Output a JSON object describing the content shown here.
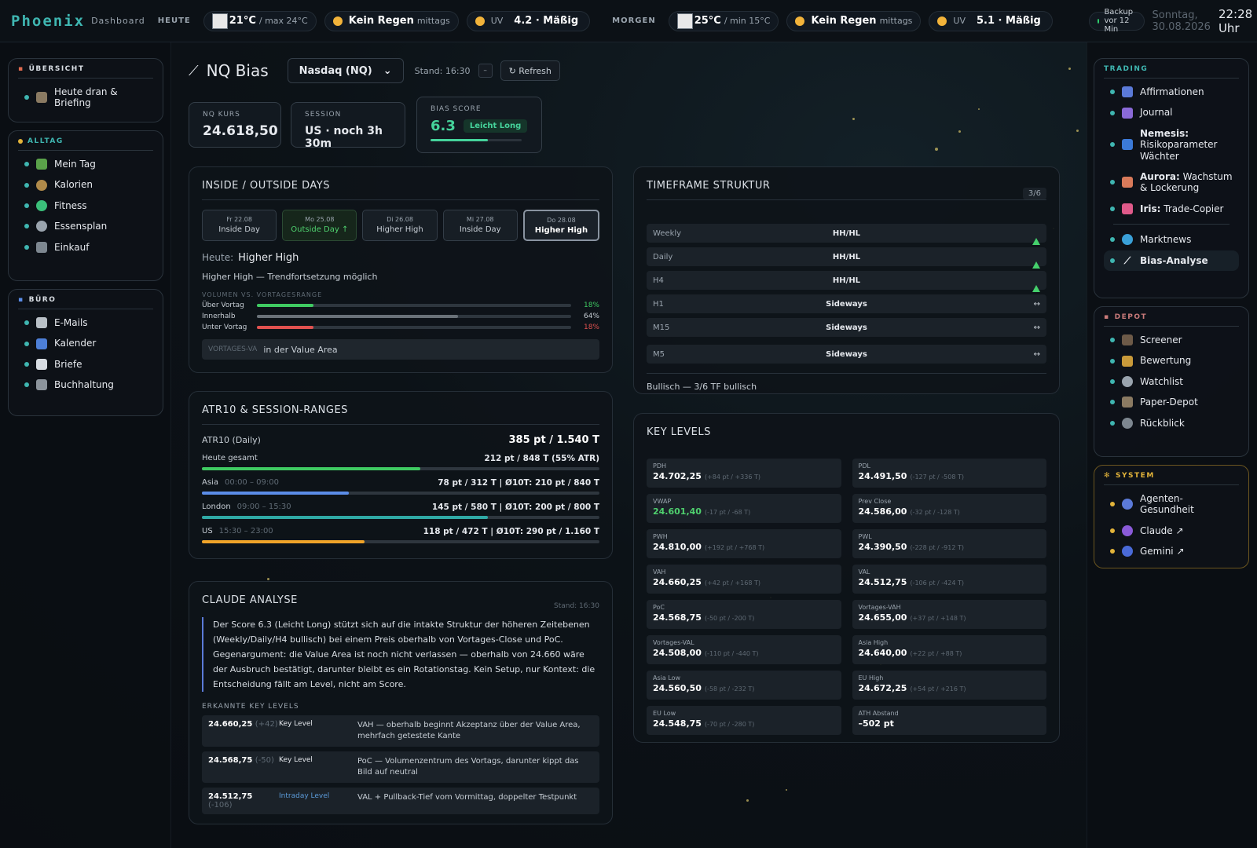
{
  "topbar": {
    "logo": "Phoenix",
    "logo_sub": "Dashboard",
    "heute_label": "HEUTE",
    "morgen_label": "MORGEN",
    "today": {
      "temp": "21°C",
      "max": "/ max 24°C",
      "rain": "Kein Regen",
      "rain_when": "mittags",
      "uv_label": "UV",
      "uv": "4.2 · Mäßig"
    },
    "tomorrow": {
      "temp": "25°C",
      "min": "/ min 15°C",
      "rain": "Kein Regen",
      "rain_when": "mittags",
      "uv_label": "UV",
      "uv": "5.1 · Mäßig"
    },
    "backup": "Backup vor 12 Min",
    "date": "Sonntag, 30.08.2026",
    "time": "22:28 Uhr"
  },
  "left": {
    "uebersicht": {
      "title": "ÜBERSICHT",
      "items": [
        "Heute dran & Briefing"
      ]
    },
    "alltag": {
      "title": "ALLTAG",
      "items": [
        "Mein Tag",
        "Kalorien",
        "Fitness",
        "Essensplan",
        "Einkauf"
      ]
    },
    "buero": {
      "title": "BÜRO",
      "items": [
        "E-Mails",
        "Kalender",
        "Briefe",
        "Buchhaltung"
      ]
    }
  },
  "right": {
    "trading": {
      "title": "TRADING",
      "items": [
        {
          "b": "",
          "t": "Affirmationen"
        },
        {
          "b": "",
          "t": "Journal"
        },
        {
          "b": "Nemesis:",
          "t": " Risikoparameter Wächter"
        },
        {
          "b": "Aurora:",
          "t": " Wachstum & Lockerung"
        },
        {
          "b": "Iris:",
          "t": " Trade-Copier"
        }
      ],
      "items2": [
        "Marktnews",
        "Bias-Analyse"
      ]
    },
    "depot": {
      "title": "DEPOT",
      "items": [
        "Screener",
        "Bewertung",
        "Watchlist",
        "Paper-Depot",
        "Rückblick"
      ]
    },
    "system": {
      "title": "SYSTEM",
      "items": [
        "Agenten-Gesundheit",
        "Claude ↗",
        "Gemini ↗"
      ]
    }
  },
  "header": {
    "title": "NQ Bias",
    "select": "Nasdaq (NQ)",
    "stand": "Stand: 16:30",
    "minus": "–",
    "refresh": "↻ Refresh"
  },
  "stats": {
    "kurs_label": "NQ KURS",
    "kurs": "24.618,50",
    "session_label": "SESSION",
    "session": "US · noch 3h 30m",
    "bias_label": "BIAS SCORE",
    "bias": "6.3",
    "bias_tag": "Leicht Long",
    "bias_fraction": 0.63
  },
  "inside": {
    "title": "INSIDE / OUTSIDE DAYS",
    "days": [
      {
        "d": "Fr 22.08",
        "t": "Inside Day"
      },
      {
        "d": "Mo 25.08",
        "t": "Outside Day ↑"
      },
      {
        "d": "Di 26.08",
        "t": "Higher High"
      },
      {
        "d": "Mi 27.08",
        "t": "Inside Day"
      },
      {
        "d": "Do 28.08",
        "t": "Higher High"
      }
    ],
    "heute_label": "Heute:",
    "heute": "Higher High",
    "desc": "Higher High — Trendfortsetzung möglich",
    "vol_title": "VOLUMEN VS. VORTAGESRANGE",
    "vol": [
      {
        "l": "Über Vortag",
        "p": "18%",
        "v": 18,
        "c": "#3fcb62"
      },
      {
        "l": "Innerhalb",
        "p": "64%",
        "v": 64,
        "c": "#6a7279"
      },
      {
        "l": "Unter Vortag",
        "p": "18%",
        "v": 18,
        "c": "#e0514f"
      }
    ],
    "va_label": "VORTAGES-VA",
    "va": "in der Value Area"
  },
  "timeframe": {
    "title": "TIMEFRAME STRUKTUR",
    "count": "3/6",
    "rows": [
      {
        "k": "Weekly",
        "v": "HH/HL",
        "up": true
      },
      {
        "k": "Daily",
        "v": "HH/HL",
        "up": true
      },
      {
        "k": "H4",
        "v": "HH/HL",
        "up": true
      },
      {
        "k": "H1",
        "v": "Sideways",
        "up": false
      },
      {
        "k": "M15",
        "v": "Sideways",
        "up": false
      },
      {
        "k": "M5",
        "v": "Sideways",
        "up": false
      }
    ],
    "side_sym": "↔",
    "summary": "Bullisch — 3/6 TF bullisch"
  },
  "atr": {
    "title": "ATR10 & SESSION-RANGES",
    "label": "ATR10 (Daily)",
    "value": "385 pt / 1.540 T",
    "sessions": [
      {
        "n": "Heute gesamt",
        "tm": "",
        "r": "212 pt / 848 T (55% ATR)",
        "v": 55,
        "c": "#3fcb62"
      },
      {
        "n": "Asia",
        "tm": "00:00 – 09:00",
        "r": "78 pt / 312 T | Ø10T: 210 pt / 840 T",
        "v": 37,
        "c": "#5b8de8"
      },
      {
        "n": "London",
        "tm": "09:00 – 15:30",
        "r": "145 pt / 580 T | Ø10T: 200 pt / 800 T",
        "v": 72,
        "c": "#2fa9a5"
      },
      {
        "n": "US",
        "tm": "15:30 – 23:00",
        "r": "118 pt / 472 T | Ø10T: 290 pt / 1.160 T",
        "v": 41,
        "c": "#f0a429"
      }
    ]
  },
  "claude": {
    "title": "CLAUDE ANALYSE",
    "stand": "Stand: 16:30",
    "text": "Der Score 6.3 (Leicht Long) stützt sich auf die intakte Struktur der höheren Zeitebenen (Weekly/Daily/H4 bullisch) bei einem Preis oberhalb von Vortages-Close und PoC. Gegenargument: die Value Area ist noch nicht verlassen — oberhalb von 24.660 wäre der Ausbruch bestätigt, darunter bleibt es ein Rotationstag. Kein Setup, nur Kontext: die Entscheidung fällt am Level, nicht am Score.",
    "kl_title": "ERKANNTE KEY LEVELS",
    "levels": [
      {
        "v": "24.660,25",
        "d": "(+42)",
        "t": "Key Level",
        "txt": "VAH — oberhalb beginnt Akzeptanz über der Value Area, mehrfach getestete Kante"
      },
      {
        "v": "24.568,75",
        "d": "(-50)",
        "t": "Key Level",
        "txt": "PoC — Volumenzentrum des Vortags, darunter kippt das Bild auf neutral"
      },
      {
        "v": "24.512,75",
        "d": "(-106)",
        "t": "Intraday Level",
        "txt": "VAL + Pullback-Tief vom Vormittag, doppelter Testpunkt"
      }
    ]
  },
  "keylevels": {
    "title": "KEY LEVELS",
    "items": [
      {
        "n": "PDH",
        "v": "24.702,25",
        "d": "(+84 pt / +336 T)"
      },
      {
        "n": "PDL",
        "v": "24.491,50",
        "d": "(-127 pt / -508 T)"
      },
      {
        "n": "VWAP",
        "v": "24.601,40",
        "d": "(-17 pt / -68 T)",
        "green": true
      },
      {
        "n": "Prev Close",
        "v": "24.586,00",
        "d": "(-32 pt / -128 T)"
      },
      {
        "n": "PWH",
        "v": "24.810,00",
        "d": "(+192 pt / +768 T)"
      },
      {
        "n": "PWL",
        "v": "24.390,50",
        "d": "(-228 pt / -912 T)"
      },
      {
        "n": "VAH",
        "v": "24.660,25",
        "d": "(+42 pt / +168 T)"
      },
      {
        "n": "VAL",
        "v": "24.512,75",
        "d": "(-106 pt / -424 T)"
      },
      {
        "n": "PoC",
        "v": "24.568,75",
        "d": "(-50 pt / -200 T)"
      },
      {
        "n": "Vortages-VAH",
        "v": "24.655,00",
        "d": "(+37 pt / +148 T)"
      },
      {
        "n": "Vortages-VAL",
        "v": "24.508,00",
        "d": "(-110 pt / -440 T)"
      },
      {
        "n": "Asia High",
        "v": "24.640,00",
        "d": "(+22 pt / +88 T)"
      },
      {
        "n": "Asia Low",
        "v": "24.560,50",
        "d": "(-58 pt / -232 T)"
      },
      {
        "n": "EU High",
        "v": "24.672,25",
        "d": "(+54 pt / +216 T)"
      },
      {
        "n": "EU Low",
        "v": "24.548,75",
        "d": "(-70 pt / -280 T)"
      },
      {
        "n": "ATH Abstand",
        "v": "–502 pt",
        "d": ""
      }
    ]
  }
}
